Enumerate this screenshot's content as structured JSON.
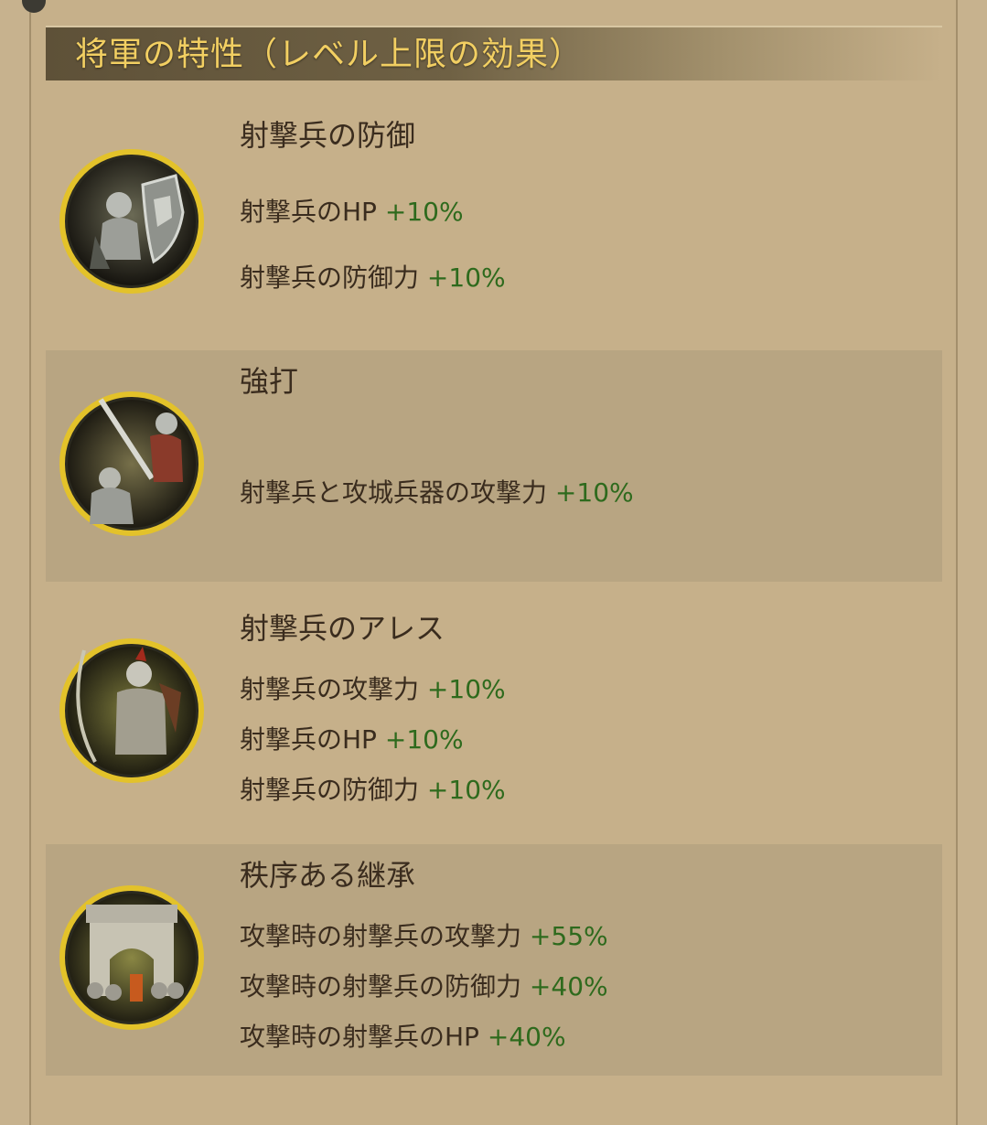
{
  "header": {
    "title": "将軍の特性（レベル上限の効果）"
  },
  "colors": {
    "title": "#f2cf62",
    "bonus": "#2e6a1d",
    "text": "#3a2c1e",
    "medal_ring": "#e3c22a"
  },
  "traits": [
    {
      "name": "射撃兵の防御",
      "icon": "shield-knight-icon",
      "effects": [
        {
          "label": "射撃兵のHP",
          "value": "+10%"
        },
        {
          "label": "射撃兵の防御力",
          "value": "+10%"
        }
      ]
    },
    {
      "name": "強打",
      "icon": "sword-knight-icon",
      "effects": [
        {
          "label": "射撃兵と攻城兵器の攻撃力",
          "value": "+10%"
        }
      ]
    },
    {
      "name": "射撃兵のアレス",
      "icon": "archer-knight-icon",
      "effects": [
        {
          "label": "射撃兵の攻撃力",
          "value": "+10%"
        },
        {
          "label": "射撃兵のHP",
          "value": "+10%"
        },
        {
          "label": "射撃兵の防御力",
          "value": "+10%"
        }
      ]
    },
    {
      "name": "秩序ある継承",
      "icon": "arch-monument-icon",
      "effects": [
        {
          "label": "攻撃時の射撃兵の攻撃力",
          "value": "+55%"
        },
        {
          "label": "攻撃時の射撃兵の防御力",
          "value": "+40%"
        },
        {
          "label": "攻撃時の射撃兵のHP",
          "value": "+40%"
        }
      ]
    }
  ]
}
